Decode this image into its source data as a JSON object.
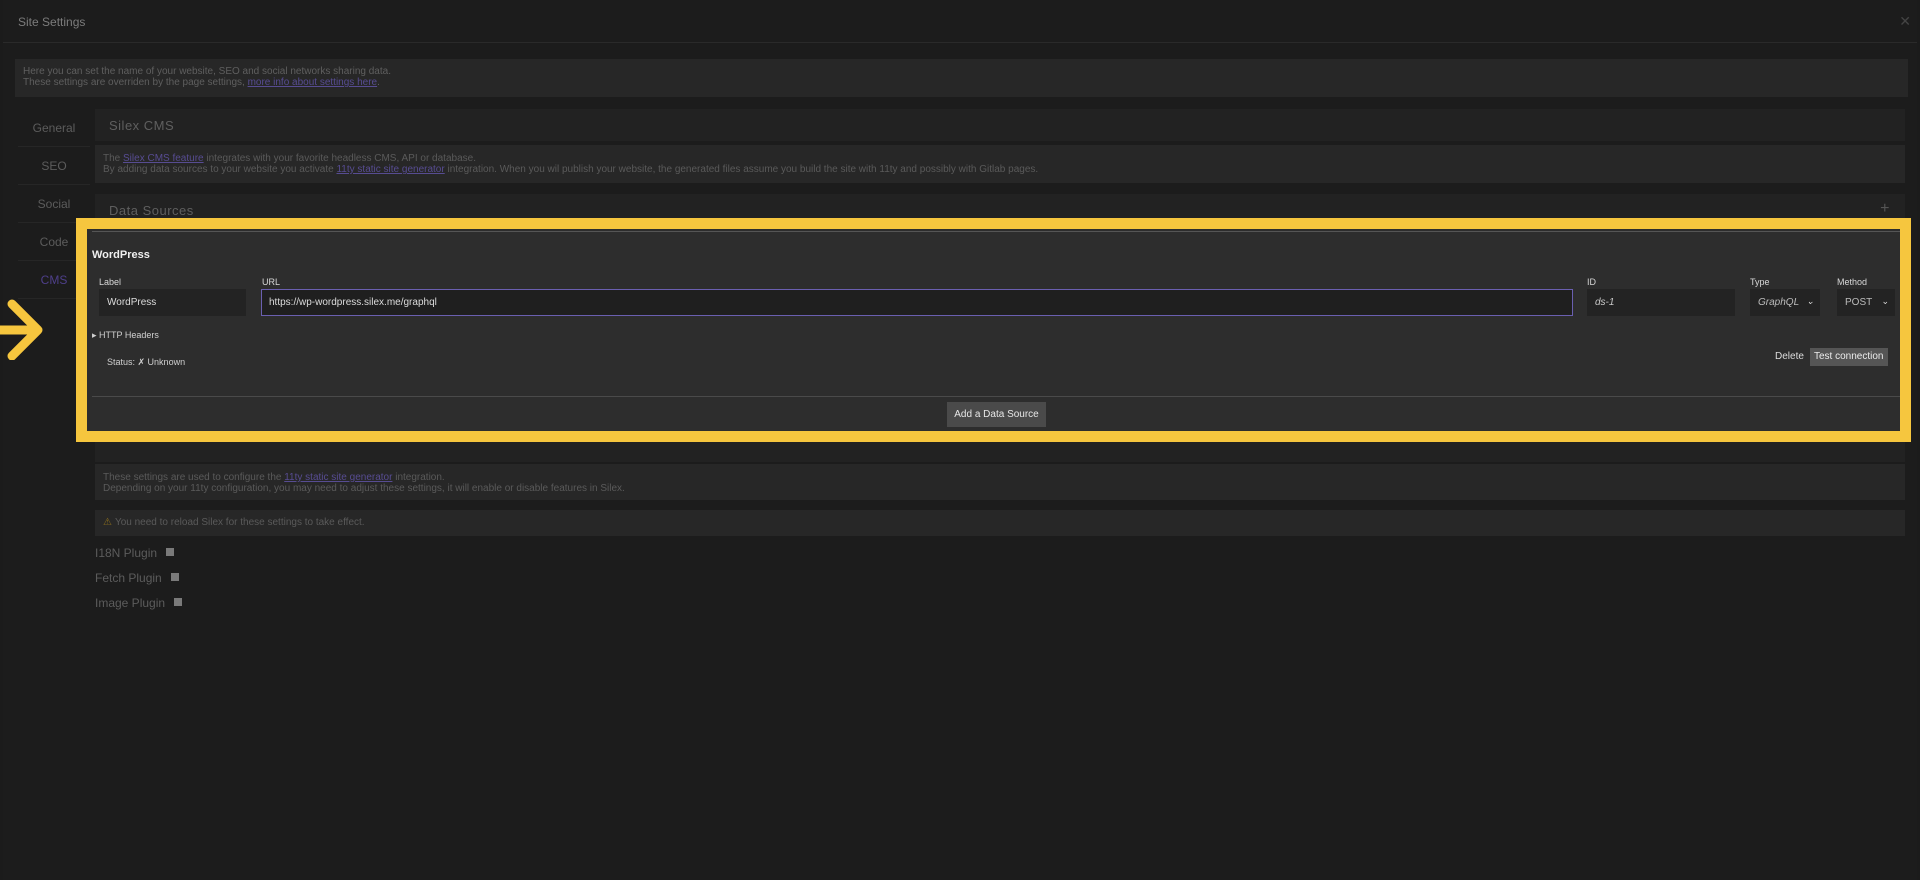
{
  "modal": {
    "title": "Site Settings",
    "close": "✕"
  },
  "intro": {
    "line1": "Here you can set the name of your website, SEO and social networks sharing data.",
    "line2_prefix": "These settings are overriden by the page settings,",
    "line2_link": "more info about settings here",
    "line2_suffix": "."
  },
  "tabs": [
    {
      "label": "General"
    },
    {
      "label": "SEO"
    },
    {
      "label": "Social"
    },
    {
      "label": "Code"
    },
    {
      "label": "CMS",
      "active": true
    }
  ],
  "cms_section": {
    "title": "Silex CMS",
    "info": {
      "l1_prefix": "The",
      "l1_link": "Silex CMS feature",
      "l1_suffix": "integrates with your favorite headless CMS, API or database.",
      "l2_prefix": "By adding data sources to your website you activate",
      "l2_link": "11ty static site generator",
      "l2_suffix": "integration. When you wil publish your website, the generated files assume you build the site with 11ty and possibly with Gitlab pages."
    }
  },
  "data_sources": {
    "title": "Data Sources",
    "add_icon": "+",
    "source": {
      "title": "WordPress",
      "label_caption": "Label",
      "label_value": "WordPress",
      "url_caption": "URL",
      "url_value": "https://wp-wordpress.silex.me/graphql",
      "id_caption": "ID",
      "id_value": "ds-1",
      "type_caption": "Type",
      "type_value": "GraphQL",
      "method_caption": "Method",
      "method_value": "POST",
      "headers_toggle": "▸ HTTP Headers",
      "status": "Status: ✗ Unknown",
      "delete_label": "Delete",
      "test_label": "Test connection"
    },
    "add_button": "Add a Data Source"
  },
  "eleventy": {
    "info_l1_prefix": "These settings are used to configure the",
    "info_l1_link": "11ty static site generator",
    "info_l1_suffix": "integration.",
    "info_l2": "Depending on your 11ty configuration, you may need to adjust these settings, it will enable or disable features in Silex.",
    "warning": "You need to reload Silex for these settings to take effect.",
    "plugins": [
      {
        "label": "I18N Plugin"
      },
      {
        "label": "Fetch Plugin"
      },
      {
        "label": "Image Plugin"
      }
    ]
  },
  "colors": {
    "highlight": "#f6c63e",
    "accent": "#574c92",
    "background": "#1c1c1c"
  }
}
